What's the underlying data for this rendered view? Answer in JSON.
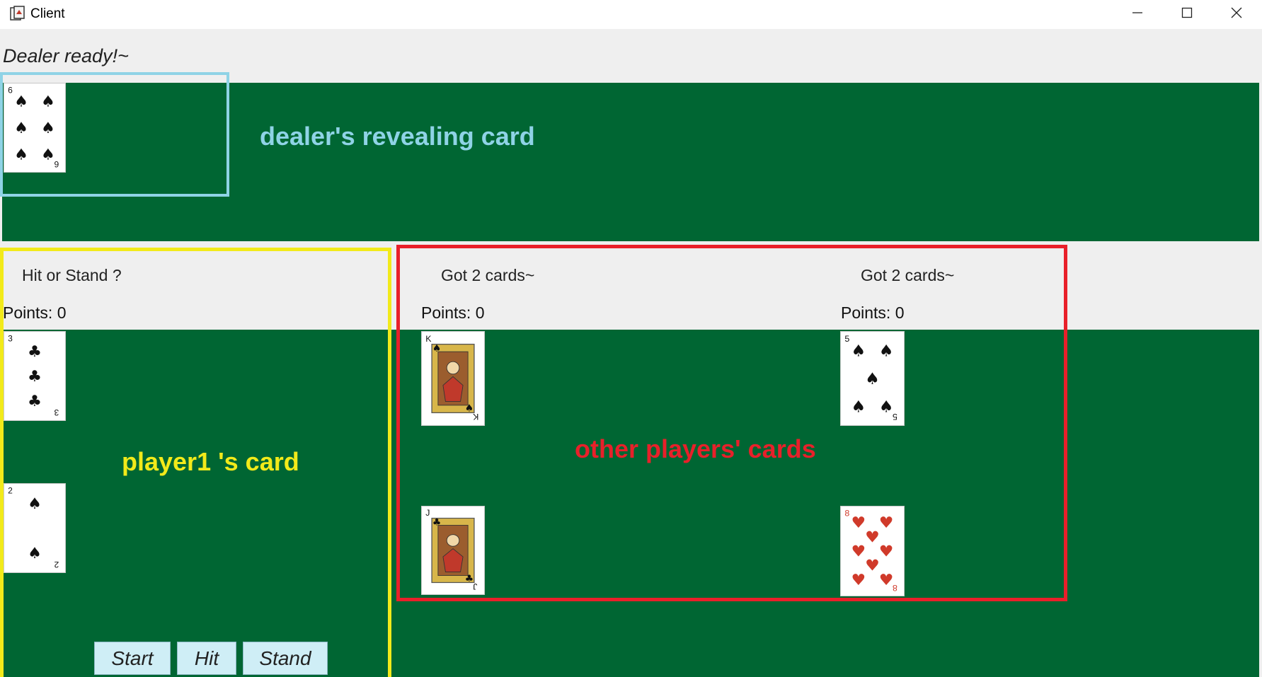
{
  "window": {
    "title": "Client",
    "icon": "java-app-icon"
  },
  "controls": {
    "minimize": "minimize-icon",
    "maximize": "maximize-icon",
    "close": "close-icon"
  },
  "status": "Dealer ready!~",
  "dealer": {
    "cards": [
      {
        "rank": "6",
        "suit": "spades"
      }
    ]
  },
  "player1": {
    "message": "Hit or Stand ?",
    "points": "Points: 0",
    "cards": [
      {
        "rank": "3",
        "suit": "clubs"
      },
      {
        "rank": "2",
        "suit": "spades"
      }
    ]
  },
  "others": [
    {
      "message": "Got 2 cards~",
      "points": "Points: 0",
      "cards": [
        {
          "rank": "K",
          "suit": "spades"
        },
        {
          "rank": "J",
          "suit": "clubs"
        }
      ]
    },
    {
      "message": "Got 2 cards~",
      "points": "Points: 0",
      "cards": [
        {
          "rank": "5",
          "suit": "spades"
        },
        {
          "rank": "8",
          "suit": "hearts"
        }
      ]
    }
  ],
  "buttons": {
    "start": "Start",
    "hit": "Hit",
    "stand": "Stand"
  },
  "annotations": {
    "dealer": "dealer's revealing card",
    "player": "player1 's card",
    "others": "other players' cards"
  },
  "colors": {
    "felt": "#006633",
    "dealer_box": "#8fd3e6",
    "player_box": "#f2ea1a",
    "others_box": "#e8202a",
    "button": "#cfeef6"
  }
}
